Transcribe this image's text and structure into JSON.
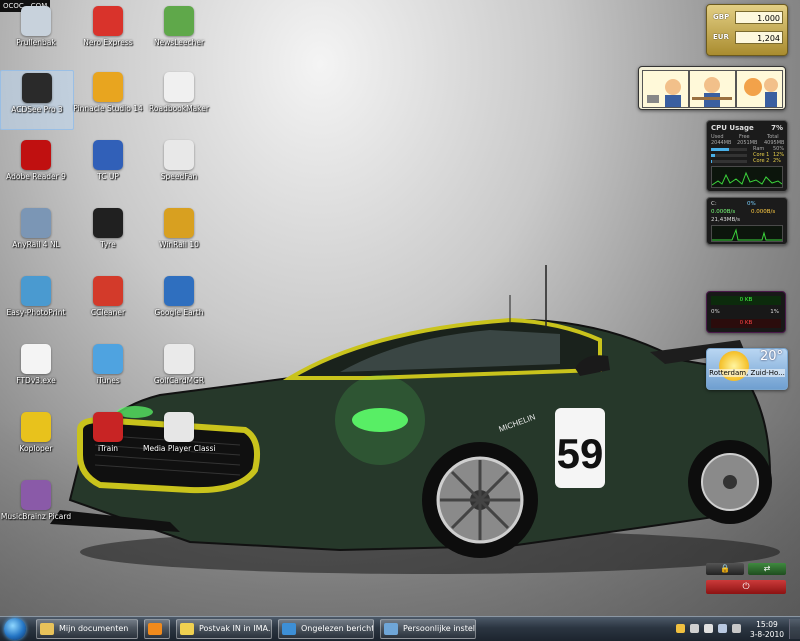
{
  "site_tag": "OCOC…COM",
  "desktop_icons": [
    {
      "label": "Prullenbak",
      "icon": "recycle-bin-icon",
      "color": "#c8d2dc"
    },
    {
      "label": "Nero Express",
      "icon": "nero-icon",
      "color": "#d9332b"
    },
    {
      "label": "NewsLeecher",
      "icon": "newsleecher-icon",
      "color": "#5fa84a"
    },
    {
      "label": "ACDSee Pro 3",
      "icon": "camera-icon",
      "color": "#2a2a2a"
    },
    {
      "label": "Pinnacle Studio 14",
      "icon": "pinnacle-icon",
      "color": "#e8a51f"
    },
    {
      "label": "RoadbookMaker",
      "icon": "roadbook-icon",
      "color": "#f0f0f0"
    },
    {
      "label": "Adobe Reader 9",
      "icon": "adobe-reader-icon",
      "color": "#c01010"
    },
    {
      "label": "TC UP",
      "icon": "tcup-icon",
      "color": "#3160b8"
    },
    {
      "label": "SpeedFan",
      "icon": "fan-icon",
      "color": "#e8e8e8"
    },
    {
      "label": "AnyRail 4 NL",
      "icon": "anyrail-icon",
      "color": "#7b96b5"
    },
    {
      "label": "Tyre",
      "icon": "tyre-icon",
      "color": "#202020"
    },
    {
      "label": "WinRail 10",
      "icon": "train-icon",
      "color": "#d8a020"
    },
    {
      "label": "Easy-PhotoPrint",
      "icon": "photoprint-icon",
      "color": "#4a9ad0"
    },
    {
      "label": "CCleaner",
      "icon": "ccleaner-icon",
      "color": "#d33a2a"
    },
    {
      "label": "Google Earth",
      "icon": "globe-icon",
      "color": "#2f6fbf"
    },
    {
      "label": "FTDv3.exe",
      "icon": "ftd-icon",
      "color": "#f4f4f4"
    },
    {
      "label": "iTunes",
      "icon": "itunes-icon",
      "color": "#4fa3e0"
    },
    {
      "label": "GolfCardMGR",
      "icon": "golf-icon",
      "color": "#eaeaea"
    },
    {
      "label": "Koploper",
      "icon": "koploper-icon",
      "color": "#e8c21c"
    },
    {
      "label": "iTrain",
      "icon": "itrain-icon",
      "color": "#c82424"
    },
    {
      "label": "Media Player Classic",
      "icon": "mpc-icon",
      "color": "#e6e6e6"
    },
    {
      "label": "MusicBrainz Picard",
      "icon": "picard-icon",
      "color": "#8a5aa8"
    }
  ],
  "currency": {
    "rows": [
      {
        "code": "GBP",
        "value": "1.000"
      },
      {
        "code": "EUR",
        "value": "1,204"
      }
    ]
  },
  "cpu": {
    "title": "CPU Usage",
    "percent": "7%",
    "mem_labels": [
      "Used",
      "Free",
      "Total"
    ],
    "mem_values": [
      "2044MB",
      "2051MB",
      "4095MB"
    ],
    "ram_label": "Ram",
    "ram_value": "50%",
    "ram_fraction": 0.5,
    "core1_label": "Core 1",
    "core1_value": "12%",
    "core1_fraction": 0.12,
    "core2_label": "Core 2",
    "core2_value": "2%",
    "core2_fraction": 0.02
  },
  "network": {
    "drive": "C:",
    "usage": "0%",
    "down": "0.000B/s",
    "up": "0.000B/s",
    "total": "21,43MB/s"
  },
  "ram_meter": {
    "top": "0 KB",
    "left": "0%",
    "right": "1%",
    "bottom": "0 KB"
  },
  "weather": {
    "temp": "20°",
    "city": "Rotterdam, Zuid-Ho..."
  },
  "car": {
    "number": "59",
    "sponsor": "MICHELIN"
  },
  "taskbar": {
    "tasks": [
      {
        "label": "Mijn documenten",
        "icon": "folder-icon",
        "color": "#e8c25a"
      },
      {
        "label": "",
        "icon": "media-player-icon",
        "color": "#f08a1c"
      },
      {
        "label": "Postvak IN in IMA...",
        "icon": "mail-icon",
        "color": "#f0d050"
      },
      {
        "label": "Ongelezen bericht...",
        "icon": "ie-icon",
        "color": "#3d8fd6"
      },
      {
        "label": "Persoonlijke instel...",
        "icon": "personalize-icon",
        "color": "#6fa6d8"
      }
    ],
    "time": "15:09",
    "date": "3-8-2010"
  },
  "colors": {
    "car_body": "#26382a",
    "car_trim": "#c9c31c",
    "headlight": "#5dff6a"
  }
}
